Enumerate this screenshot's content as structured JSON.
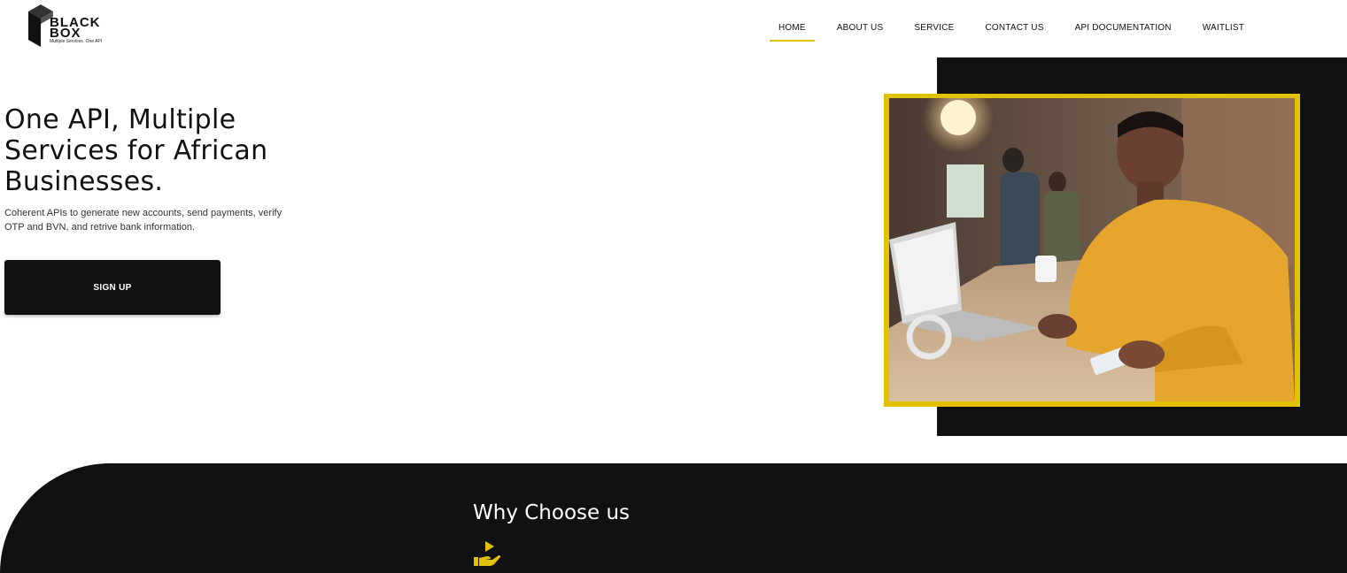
{
  "logo": {
    "brand_line1": "BLACK",
    "brand_line2": "BOX",
    "tagline": "Multiple Services. One API",
    "icon": "cube-icon"
  },
  "nav": {
    "items": [
      {
        "label": "HOME",
        "active": true
      },
      {
        "label": "ABOUT US",
        "active": false
      },
      {
        "label": "SERVICE",
        "active": false
      },
      {
        "label": "CONTACT US",
        "active": false
      },
      {
        "label": "API DOCUMENTATION",
        "active": false
      },
      {
        "label": "WAITLIST",
        "active": false
      }
    ]
  },
  "hero": {
    "title": "One API, Multiple Services for African Businesses.",
    "subtitle": "Coherent APIs to generate new accounts, send payments, verify OTP and BVN, and retrive bank information.",
    "cta_label": "SIGN UP"
  },
  "why": {
    "title": "Why Choose us",
    "icon": "hand-play-icon"
  },
  "colors": {
    "accent": "#e0c200",
    "dark": "#111111",
    "background": "#ffffff"
  }
}
